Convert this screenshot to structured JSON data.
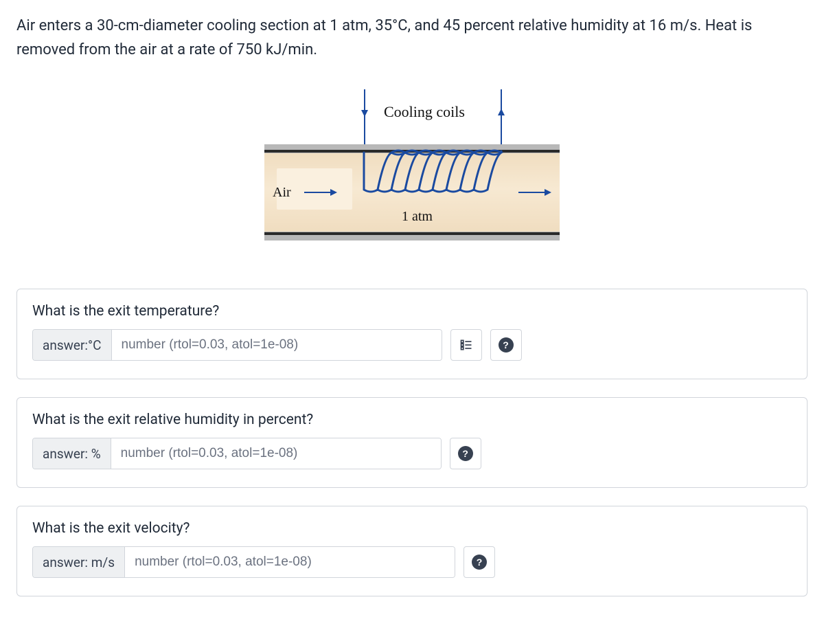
{
  "problem_text": "Air enters a 30-cm-diameter cooling section at 1 atm, 35°C, and 45 percent relative humidity at 16 m/s. Heat is removed from the air at a rate of 750 kJ/min.",
  "diagram": {
    "coil_label": "Cooling coils",
    "air_label": "Air",
    "atm_label": "1 atm"
  },
  "questions": [
    {
      "prompt": "What is the exit temperature?",
      "prefix": "answer:°C",
      "placeholder": "number (rtol=0.03, atol=1e-08)",
      "show_list_icon": true
    },
    {
      "prompt": "What is the exit relative humidity in percent?",
      "prefix": "answer: %",
      "placeholder": "number (rtol=0.03, atol=1e-08)",
      "show_list_icon": false
    },
    {
      "prompt": "What is the exit velocity?",
      "prefix": "answer: m/s",
      "placeholder": "number (rtol=0.03, atol=1e-08)",
      "show_list_icon": false
    }
  ]
}
